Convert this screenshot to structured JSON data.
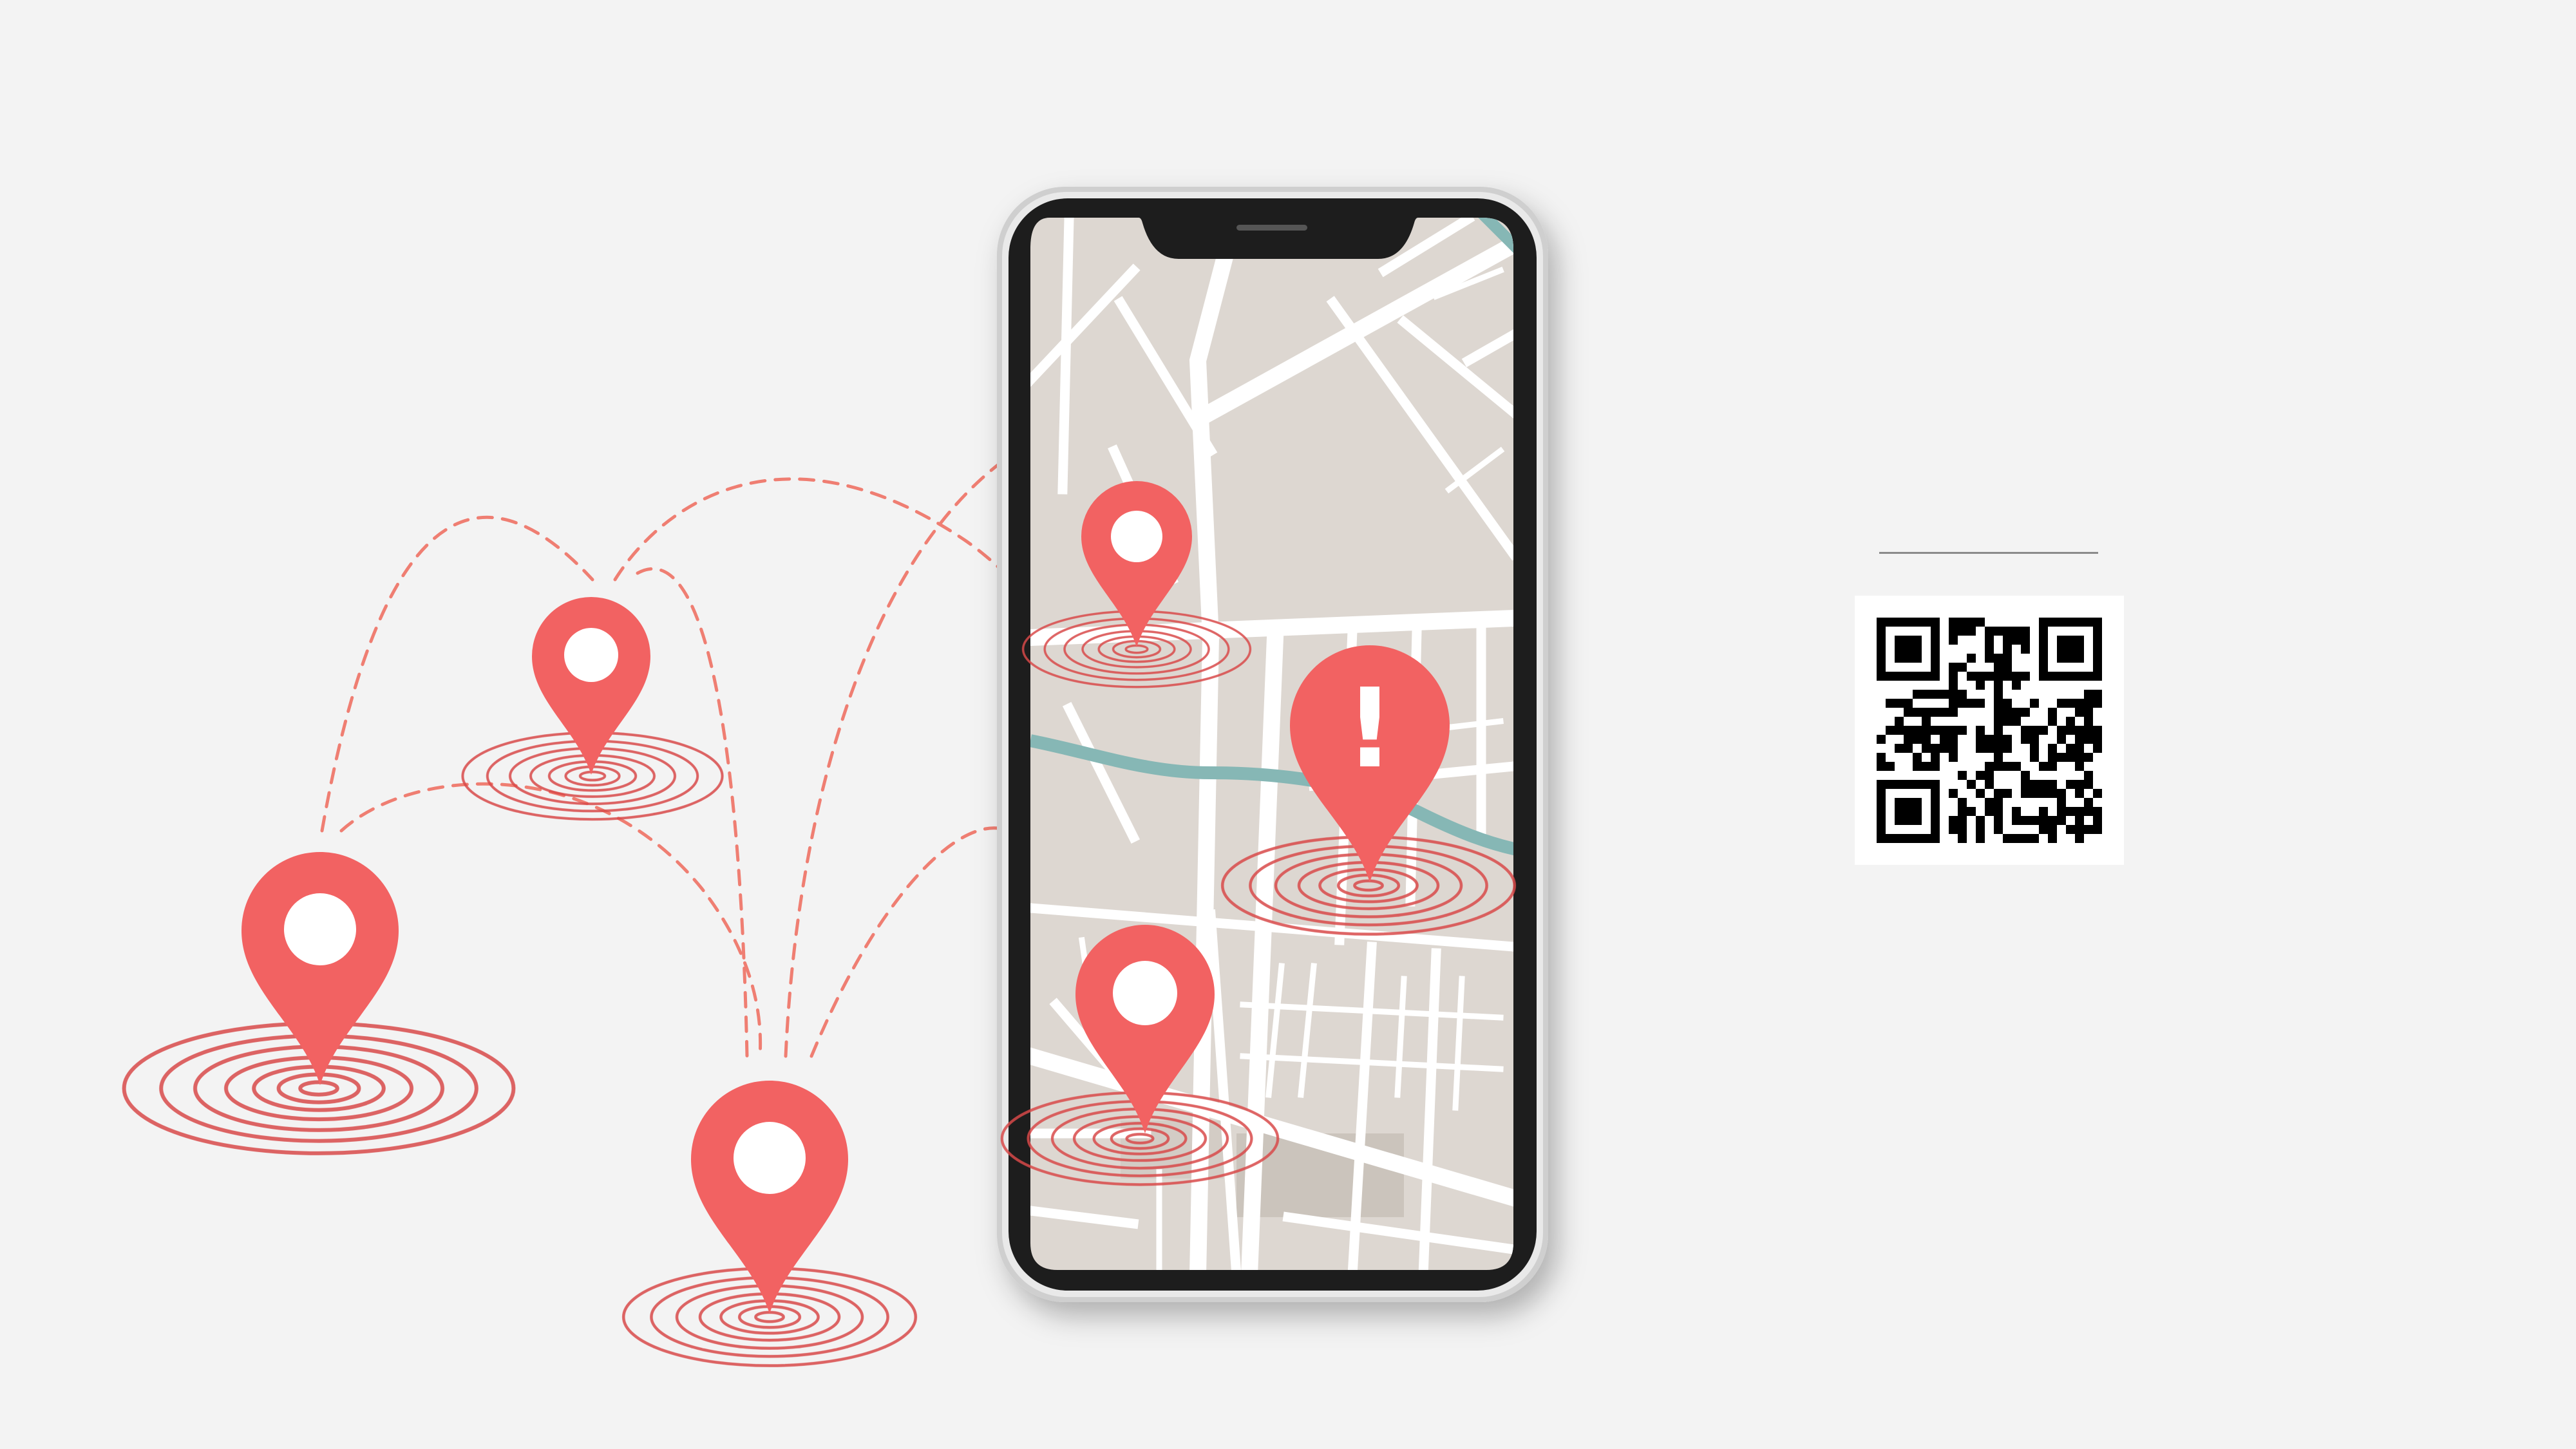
{
  "colors": {
    "background": "#f3f3f3",
    "pin": "#f26262",
    "pin_dark": "#e14d4d",
    "ripple": "#d94a4a",
    "route_dash": "#ef7e72",
    "map_land": "#ddd7d1",
    "map_road": "#ffffff",
    "map_river": "#86b7b5",
    "phone_frame": "#1d1d1d",
    "phone_bezel": "#c9c9c9"
  },
  "icons": {
    "location_pin": "location-pin-icon",
    "alert_pin": "alert-pin-icon",
    "qr": "qr-code"
  },
  "alert_pin": {
    "symbol": "!"
  }
}
